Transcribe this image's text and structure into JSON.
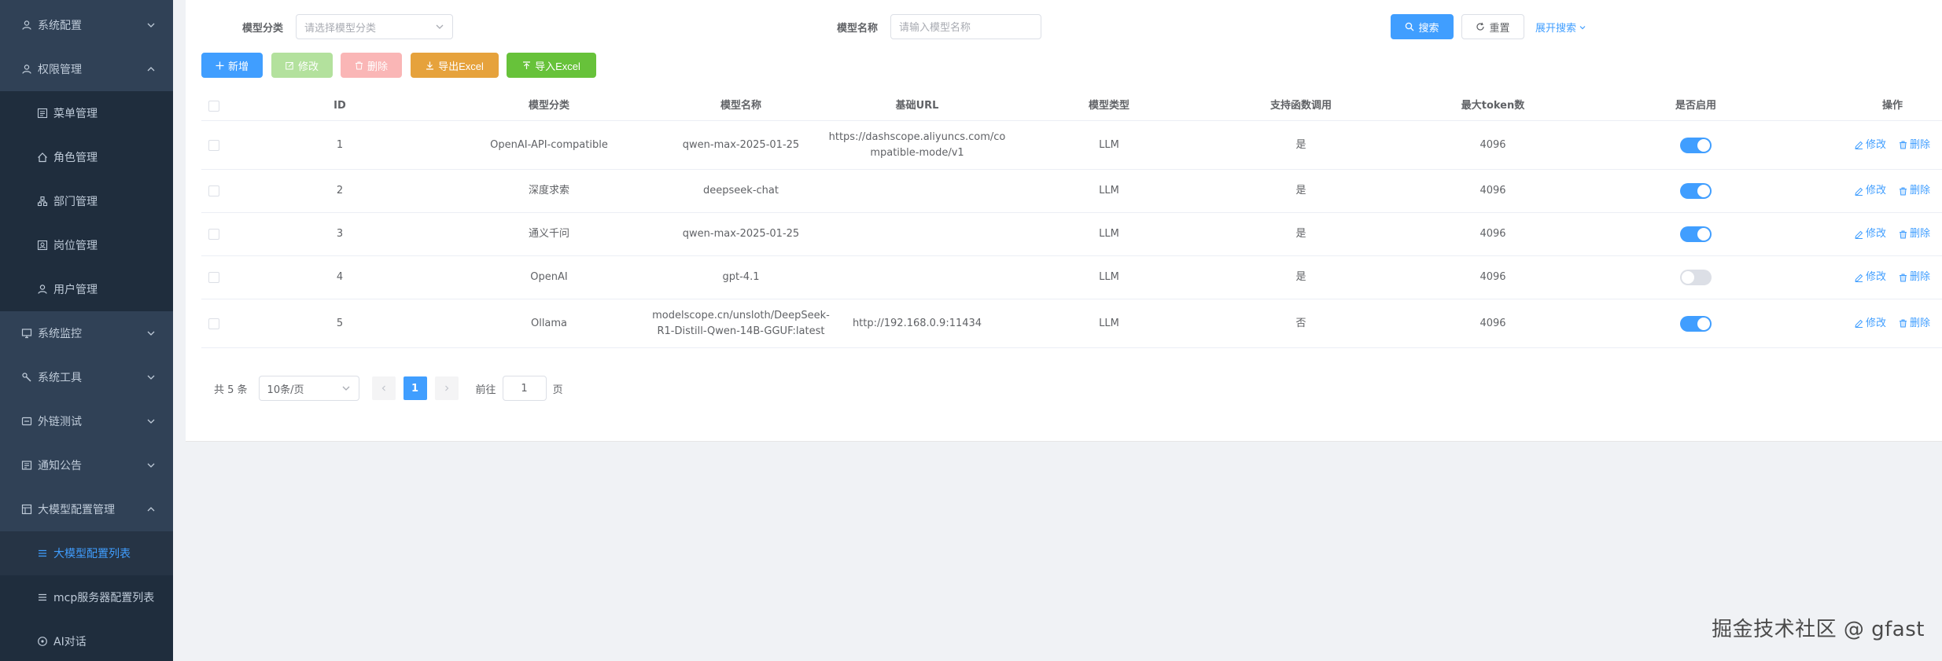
{
  "sidebar": {
    "items": [
      {
        "label": "系统配置",
        "icon": "user-icon",
        "expanded": false
      },
      {
        "label": "权限管理",
        "icon": "user-icon",
        "expanded": true
      },
      {
        "label": "菜单管理",
        "icon": "menu-icon"
      },
      {
        "label": "角色管理",
        "icon": "role-icon"
      },
      {
        "label": "部门管理",
        "icon": "department-icon"
      },
      {
        "label": "岗位管理",
        "icon": "post-icon"
      },
      {
        "label": "用户管理",
        "icon": "user-icon"
      },
      {
        "label": "系统监控",
        "icon": "monitor-icon",
        "expanded": false
      },
      {
        "label": "系统工具",
        "icon": "tool-icon",
        "expanded": false
      },
      {
        "label": "外链测试",
        "icon": "link-icon",
        "expanded": false
      },
      {
        "label": "通知公告",
        "icon": "notice-icon",
        "expanded": false
      },
      {
        "label": "大模型配置管理",
        "icon": "model-icon",
        "expanded": true
      },
      {
        "label": "大模型配置列表",
        "icon": "list-icon",
        "active": true
      },
      {
        "label": "mcp服务器配置列表",
        "icon": "list-icon"
      },
      {
        "label": "AI对话",
        "icon": "chat-icon"
      }
    ]
  },
  "search": {
    "category_label": "模型分类",
    "category_placeholder": "请选择模型分类",
    "name_label": "模型名称",
    "name_placeholder": "请输入模型名称",
    "search_btn": "搜索",
    "reset_btn": "重置",
    "expand_link": "展开搜索"
  },
  "toolbar": {
    "add": "新增",
    "edit": "修改",
    "delete": "删除",
    "export": "导出Excel",
    "import": "导入Excel"
  },
  "table": {
    "headers": [
      "ID",
      "模型分类",
      "模型名称",
      "基础URL",
      "模型类型",
      "支持函数调用",
      "最大token数",
      "是否启用",
      "操作"
    ],
    "rows": [
      {
        "id": "1",
        "category": "OpenAI-API-compatible",
        "name": "qwen-max-2025-01-25",
        "url": "https://dashscope.aliyuncs.com/co\nmpatible-mode/v1",
        "type": "LLM",
        "fn": "是",
        "tokens": "4096",
        "enabled": true
      },
      {
        "id": "2",
        "category": "深度求索",
        "name": "deepseek-chat",
        "url": "",
        "type": "LLM",
        "fn": "是",
        "tokens": "4096",
        "enabled": true
      },
      {
        "id": "3",
        "category": "通义千问",
        "name": "qwen-max-2025-01-25",
        "url": "",
        "type": "LLM",
        "fn": "是",
        "tokens": "4096",
        "enabled": true
      },
      {
        "id": "4",
        "category": "OpenAI",
        "name": "gpt-4.1",
        "url": "",
        "type": "LLM",
        "fn": "是",
        "tokens": "4096",
        "enabled": false
      },
      {
        "id": "5",
        "category": "Ollama",
        "name": "modelscope.cn/unsloth/DeepSeek-\nR1-Distill-Qwen-14B-GGUF:latest",
        "url": "http://192.168.0.9:11434",
        "type": "LLM",
        "fn": "否",
        "tokens": "4096",
        "enabled": true
      }
    ],
    "op_edit": "修改",
    "op_delete": "删除"
  },
  "pagination": {
    "total": "共 5 条",
    "page_size": "10条/页",
    "current": "1",
    "goto_prefix": "前往",
    "goto_value": "1",
    "goto_suffix": "页"
  },
  "watermark": "掘金技术社区 @ gfast",
  "colors": {
    "primary": "#409eff",
    "sidebar": "#304156",
    "success": "#67c23a",
    "warning": "#e6a23c"
  }
}
